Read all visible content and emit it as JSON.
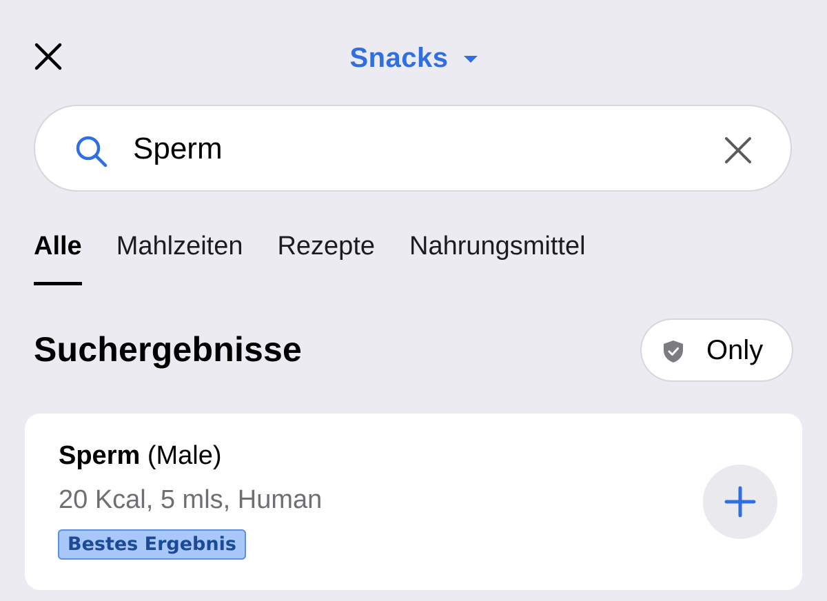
{
  "header": {
    "meal_title": "Snacks",
    "icons": {
      "close": "close-icon",
      "caret": "caret-down-icon"
    },
    "accent_color": "#2f6fe0"
  },
  "search": {
    "value": "Sperm",
    "icon": "search-icon",
    "clear_icon": "clear-icon"
  },
  "tabs": [
    {
      "label": "Alle",
      "active": true
    },
    {
      "label": "Mahlzeiten",
      "active": false
    },
    {
      "label": "Rezepte",
      "active": false
    },
    {
      "label": "Nahrungsmittel",
      "active": false
    }
  ],
  "results": {
    "title": "Suchergebnisse",
    "filter_label": "Only",
    "filter_icon": "shield-check-icon",
    "items": [
      {
        "name": "Sperm",
        "qualifier": " (Male)",
        "details": "20 Kcal, 5 mls, Human",
        "badge": "Bestes Ergebnis",
        "badge_color": "#a7c8f9",
        "add_icon": "plus-icon"
      }
    ]
  }
}
